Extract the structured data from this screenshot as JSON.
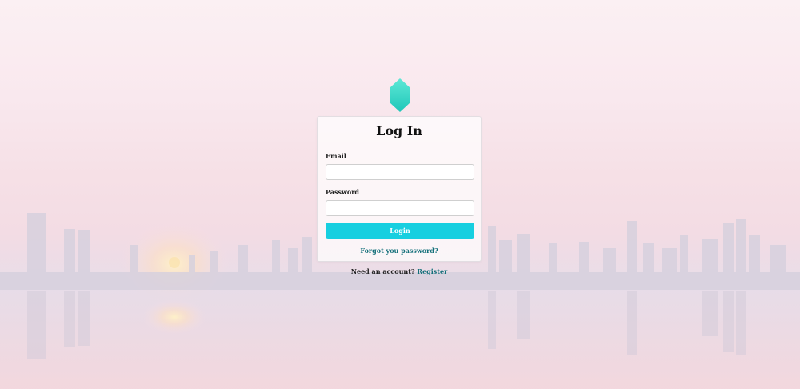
{
  "page": {
    "title": "Log In"
  },
  "logo": {
    "icon": "hexagon-logo-icon",
    "color_top": "#5ee8d6",
    "color_bottom": "#1fc7b9"
  },
  "form": {
    "email_label": "Email",
    "email_value": "",
    "email_placeholder": "",
    "password_label": "Password",
    "password_value": "",
    "password_placeholder": "",
    "login_label": "Login",
    "forgot_label": "Forgot you password?"
  },
  "footer": {
    "need_account_text": "Need an account?",
    "register_label": "Register"
  },
  "colors": {
    "accent": "#17cfe0",
    "link": "#13707a"
  }
}
